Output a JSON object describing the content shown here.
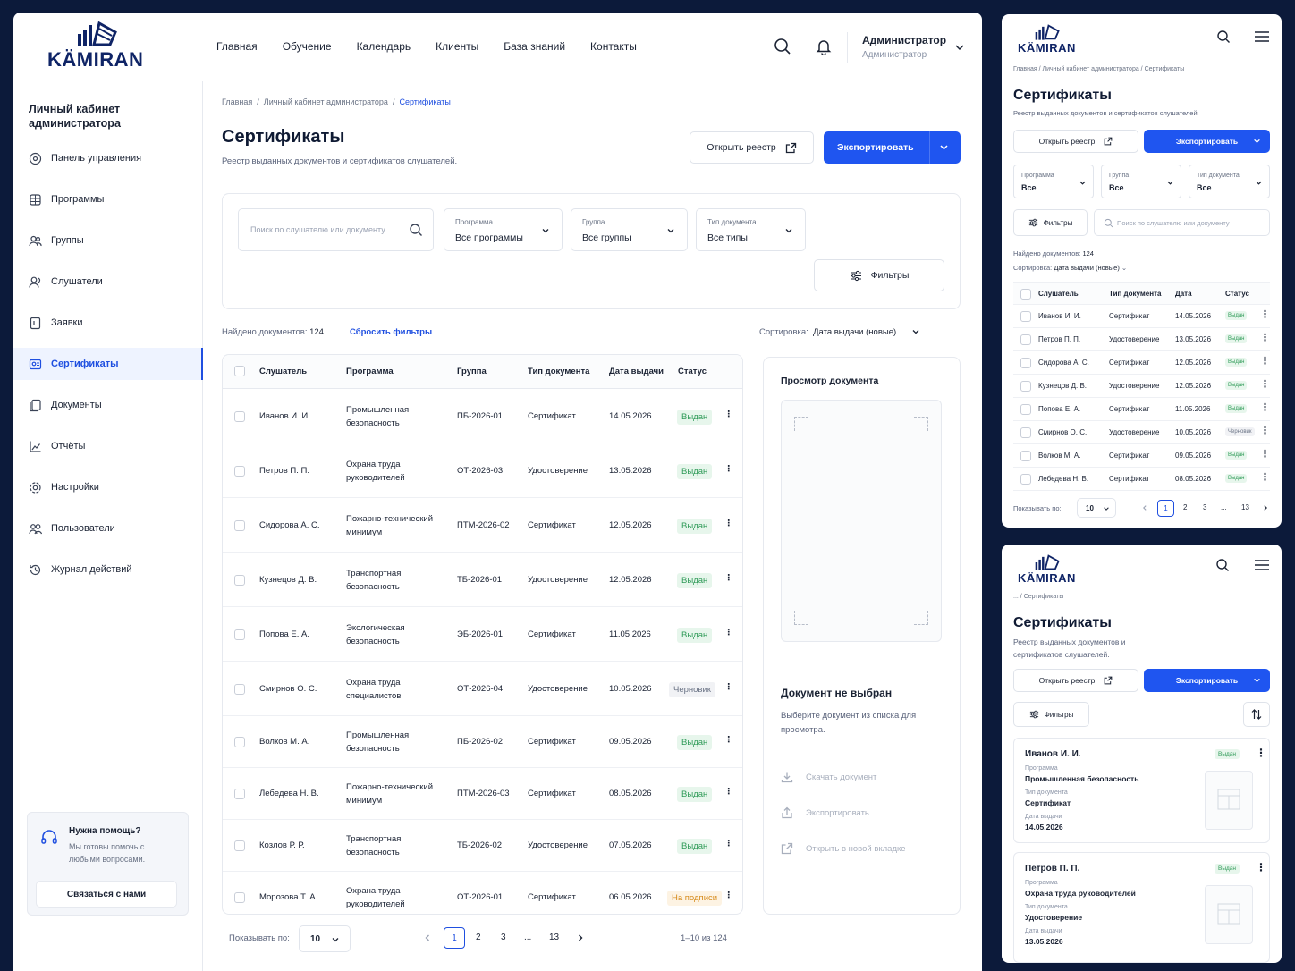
{
  "brand": {
    "name": "KÄMIRAN"
  },
  "nav": [
    "Главная",
    "Обучение",
    "Календарь",
    "Клиенты",
    "База знаний",
    "Контакты"
  ],
  "user": {
    "name": "Администратор",
    "role": "Администратор"
  },
  "sidebar": {
    "title": "Личный кабинет администратора",
    "items": [
      {
        "label": "Панель управления",
        "icon": "dashboard-icon"
      },
      {
        "label": "Программы",
        "icon": "programs-icon"
      },
      {
        "label": "Группы",
        "icon": "groups-icon"
      },
      {
        "label": "Слушатели",
        "icon": "listeners-icon"
      },
      {
        "label": "Заявки",
        "icon": "requests-icon"
      },
      {
        "label": "Сертификаты",
        "icon": "certificate-icon",
        "active": true
      },
      {
        "label": "Документы",
        "icon": "documents-icon"
      },
      {
        "label": "Отчёты",
        "icon": "reports-icon"
      },
      {
        "label": "Настройки",
        "icon": "settings-icon"
      },
      {
        "label": "Пользователи",
        "icon": "users-icon"
      },
      {
        "label": "Журнал действий",
        "icon": "history-icon"
      }
    ],
    "help": {
      "title": "Нужна помощь?",
      "text": "Мы готовы помочь с любыми вопросами.",
      "button": "Связаться с нами"
    }
  },
  "breadcrumb": {
    "home": "Главная",
    "section": "Личный кабинет администратора",
    "current": "Сертификаты",
    "mobile_prefix": "..."
  },
  "page": {
    "title": "Сертификаты",
    "subtitle": "Реестр выданных документов и сертификатов слушателей.",
    "subtitle_short_1": "Реестр выданных документов и",
    "subtitle_short_2": "сертификатов слушателей."
  },
  "actions": {
    "open_registry": "Открыть реестр",
    "export": "Экспортировать"
  },
  "filters": {
    "search_placeholder": "Поиск по слушателю или документу",
    "program": {
      "label": "Программа",
      "value": "Все программы",
      "value_short": "Все"
    },
    "group": {
      "label": "Группа",
      "value": "Все группы",
      "value_short": "Все"
    },
    "doc_type": {
      "label": "Тип документа",
      "value": "Все типы",
      "value_short": "Все"
    },
    "filters_button": "Фильтры"
  },
  "results": {
    "found_label": "Найдено документов:",
    "found_count": "124",
    "reset": "Сбросить фильтры",
    "sort_label": "Сортировка:",
    "sort_value": "Дата выдачи (новые)"
  },
  "table": {
    "headers": {
      "listener": "Слушатель",
      "program": "Программа",
      "group": "Группа",
      "doc_type": "Тип документа",
      "date": "Дата выдачи",
      "status": "Статус",
      "date_short": "Дата"
    },
    "rows": [
      {
        "name": "Иванов И. И.",
        "program": "Промышленная безопасность",
        "group": "ПБ-2026-01",
        "type": "Сертификат",
        "date": "14.05.2026",
        "status": "Выдан",
        "st": "ok"
      },
      {
        "name": "Петров П. П.",
        "program": "Охрана труда руководителей",
        "group": "ОТ-2026-03",
        "type": "Удостоверение",
        "date": "13.05.2026",
        "status": "Выдан",
        "st": "ok"
      },
      {
        "name": "Сидорова А. С.",
        "program": "Пожарно-технический минимум",
        "group": "ПТМ-2026-02",
        "type": "Сертификат",
        "date": "12.05.2026",
        "status": "Выдан",
        "st": "ok"
      },
      {
        "name": "Кузнецов Д. В.",
        "program": "Транспортная безопасность",
        "group": "ТБ-2026-01",
        "type": "Удостоверение",
        "date": "12.05.2026",
        "status": "Выдан",
        "st": "ok"
      },
      {
        "name": "Попова Е. А.",
        "program": "Экологическая безопасность",
        "group": "ЭБ-2026-01",
        "type": "Сертификат",
        "date": "11.05.2026",
        "status": "Выдан",
        "st": "ok"
      },
      {
        "name": "Смирнов О. С.",
        "program": "Охрана труда специалистов",
        "group": "ОТ-2026-04",
        "type": "Удостоверение",
        "date": "10.05.2026",
        "status": "Черновик",
        "st": "dr"
      },
      {
        "name": "Волков М. А.",
        "program": "Промышленная безопасность",
        "group": "ПБ-2026-02",
        "type": "Сертификат",
        "date": "09.05.2026",
        "status": "Выдан",
        "st": "ok"
      },
      {
        "name": "Лебедева Н. В.",
        "program": "Пожарно-технический минимум",
        "group": "ПТМ-2026-03",
        "type": "Сертификат",
        "date": "08.05.2026",
        "status": "Выдан",
        "st": "ok"
      },
      {
        "name": "Козлов Р. Р.",
        "program": "Транспортная безопасность",
        "group": "ТБ-2026-02",
        "type": "Удостоверение",
        "date": "07.05.2026",
        "status": "Выдан",
        "st": "ok"
      },
      {
        "name": "Морозова Т. А.",
        "program": "Охрана труда руководителей",
        "group": "ОТ-2026-01",
        "type": "Сертификат",
        "date": "06.05.2026",
        "status": "На подписи",
        "st": "wait"
      }
    ]
  },
  "pagination": {
    "show_label": "Показывать по:",
    "per_page": "10",
    "pages": [
      "1",
      "2",
      "3",
      "...",
      "13"
    ],
    "range": "1–10 из 124"
  },
  "preview": {
    "title": "Просмотр документа",
    "empty_title": "Документ не выбран",
    "empty_text": "Выберите документ из списка для просмотра.",
    "download": "Скачать документ",
    "export": "Экспортировать",
    "open_new": "Открыть в новой вкладке"
  },
  "mobile_card_labels": {
    "program": "Программа",
    "type": "Тип документа",
    "date": "Дата выдачи"
  },
  "colors": {
    "primary": "#1f55f0",
    "brand_dark": "#0f2466",
    "ok": "#2e9a57",
    "wait": "#d68a1a"
  }
}
